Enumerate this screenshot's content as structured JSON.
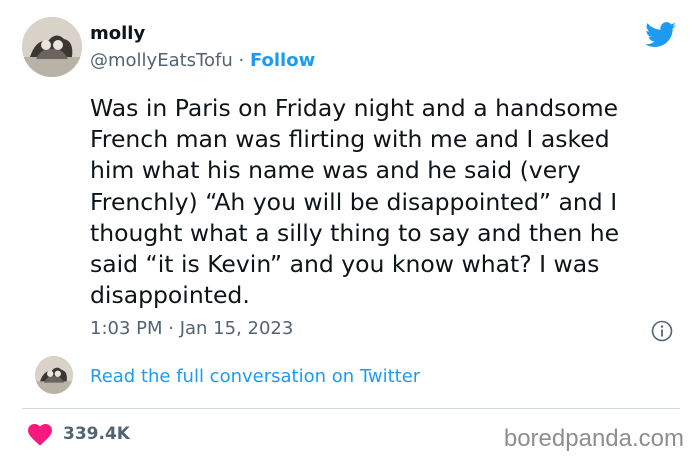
{
  "author": {
    "display_name": "molly",
    "handle": "@mollyEatsTofu",
    "separator": "·",
    "follow_label": "Follow"
  },
  "tweet": {
    "lines": [
      "Was in Paris on Friday night and a handsome",
      "French man was flirting with me and I asked",
      "him what his name was and he said (very",
      "Frenchly) “Ah you will be disappointed” and I",
      "thought what a silly thing to say and then he",
      "said “it is Kevin” and you know what? I was",
      "disappointed."
    ],
    "timestamp": "1:03 PM · Jan 15, 2023"
  },
  "conversation_link": "Read the full conversation on Twitter",
  "engagement": {
    "likes": "339.4K"
  },
  "watermark": "boredpanda.com",
  "icons": {
    "platform": "twitter-bird-icon",
    "info": "info-icon",
    "like": "heart-icon"
  },
  "colors": {
    "accent": "#1d9bf0",
    "heart": "#f91880",
    "secondary_text": "#536471"
  }
}
